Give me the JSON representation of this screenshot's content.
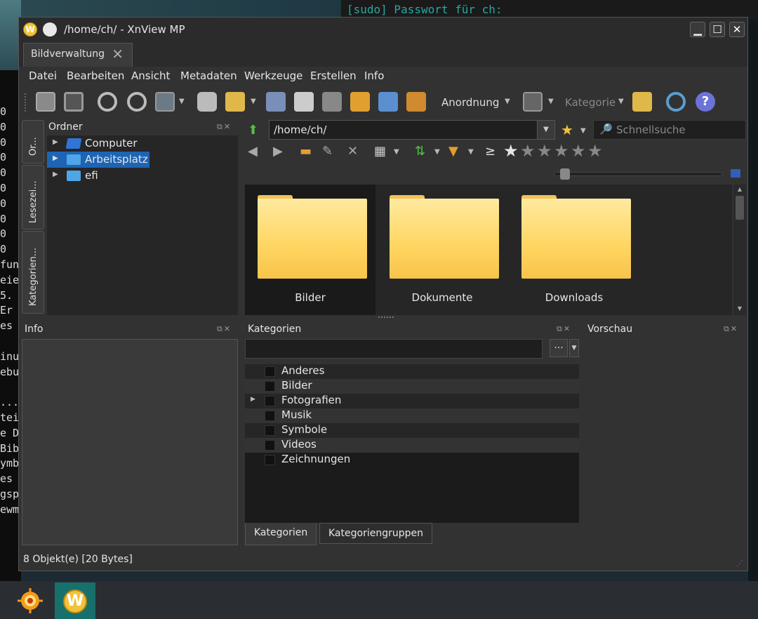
{
  "terminal": {
    "line": "[sudo] Passwort für ch:"
  },
  "terminal_left_lines": [
    "0",
    "0",
    "0",
    "0",
    "0",
    "0",
    "0",
    "0",
    "0",
    "0",
    "fun",
    "eie",
    "5.",
    "Er",
    "es",
    "",
    "inu",
    "ebu",
    "",
    "...",
    "tei",
    "e D",
    "Bib",
    "ymb",
    "es",
    "gsp",
    "ewm"
  ],
  "window": {
    "title": "/home/ch/ - XnView MP",
    "minimize": "▁",
    "maximize": "☐",
    "close": "✕"
  },
  "tab": {
    "label": "Bildverwaltung",
    "close": "✕"
  },
  "menu": [
    "Datei",
    "Bearbeiten",
    "Ansicht",
    "Metadaten",
    "Werkzeuge",
    "Erstellen",
    "Info"
  ],
  "toolbar": {
    "arrange_label": "Anordnung",
    "category_label": "Kategorie",
    "help_glyph": "?"
  },
  "sidetabs": [
    "Or...",
    "Lesezei...",
    "Kategorien..."
  ],
  "folders_panel": {
    "title": "Ordner",
    "items": [
      {
        "label": "Computer",
        "selected": false
      },
      {
        "label": "Arbeitsplatz",
        "selected": true
      },
      {
        "label": "efi",
        "selected": false
      }
    ]
  },
  "browser": {
    "path": "/home/ch/",
    "search_placeholder": "Schnellsuche",
    "rating_filter_symbol": "≥",
    "rating_stars": 6,
    "thumbnails": [
      "Bilder",
      "Dokumente",
      "Downloads"
    ]
  },
  "info_panel": {
    "title": "Info"
  },
  "categories_panel": {
    "title": "Kategorien",
    "button_label": "...",
    "items": [
      {
        "label": "Anderes",
        "expandable": false
      },
      {
        "label": "Bilder",
        "expandable": false
      },
      {
        "label": "Fotografien",
        "expandable": true
      },
      {
        "label": "Musik",
        "expandable": false
      },
      {
        "label": "Symbole",
        "expandable": false
      },
      {
        "label": "Videos",
        "expandable": false
      },
      {
        "label": "Zeichnungen",
        "expandable": false
      }
    ],
    "tabs": [
      "Kategorien",
      "Kategoriengruppen"
    ]
  },
  "preview_panel": {
    "title": "Vorschau"
  },
  "status": {
    "text": "8 Objekt(e) [20 Bytes]"
  },
  "colors": {
    "accent_selected": "#1e64b4",
    "folder": "#ffd561",
    "terminal_text": "#27a7a0"
  }
}
